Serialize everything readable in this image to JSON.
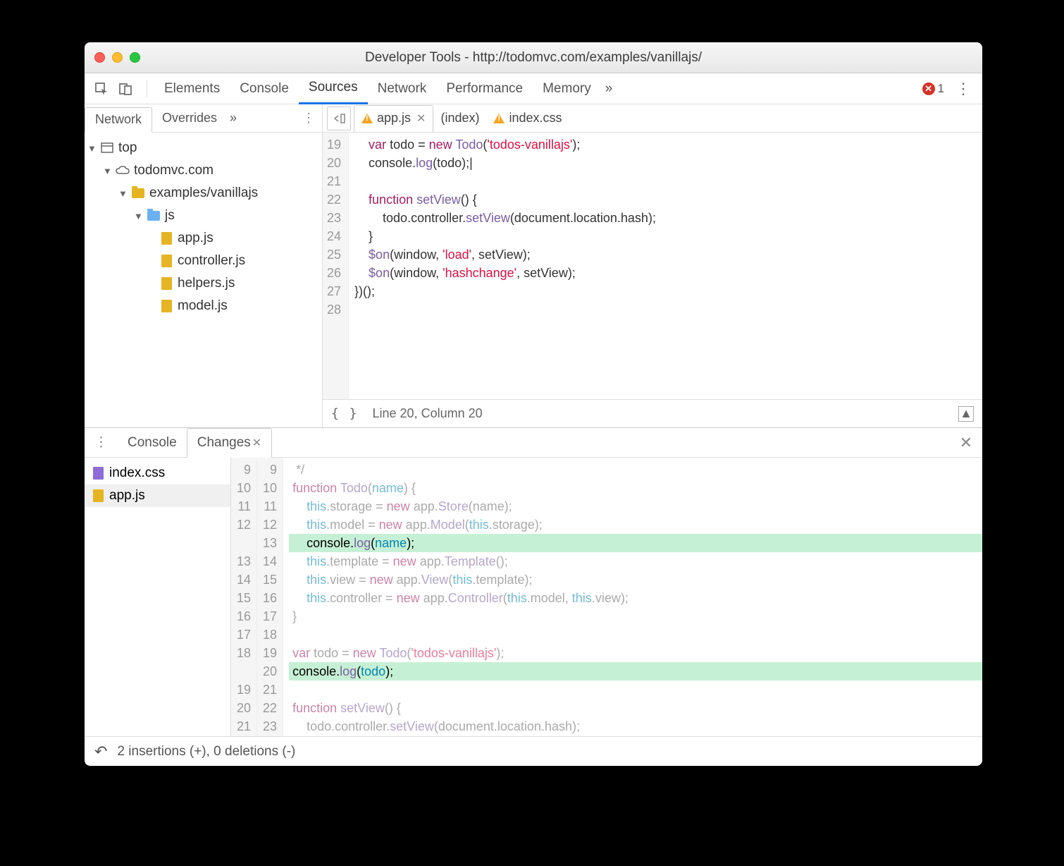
{
  "window": {
    "title": "Developer Tools - http://todomvc.com/examples/vanillajs/"
  },
  "toolbar": {
    "tabs": [
      "Elements",
      "Console",
      "Sources",
      "Network",
      "Performance",
      "Memory"
    ],
    "active_index": 2,
    "overflow_glyph": "»",
    "error_count": "1"
  },
  "left_pane": {
    "tabs": [
      "Network",
      "Overrides"
    ],
    "active_index": 0,
    "overflow_glyph": "»",
    "tree": {
      "root": "top",
      "origin": "todomvc.com",
      "folder": "examples/vanillajs",
      "subfolder": "js",
      "files": [
        "app.js",
        "controller.js",
        "helpers.js",
        "model.js"
      ]
    }
  },
  "editor": {
    "tabs": [
      {
        "name": "app.js",
        "warning": true,
        "active": true,
        "closable": true
      },
      {
        "name": "(index)",
        "warning": false,
        "active": false,
        "closable": false
      },
      {
        "name": "index.css",
        "warning": true,
        "active": false,
        "closable": false
      }
    ],
    "first_line_no": 19,
    "lines_html": [
      "    <span class='kw'>var</span> todo = <span class='kw'>new</span> <span class='fn'>Todo</span>(<span class='str'>'todos-vanillajs'</span>);",
      "    console.<span class='fn'>log</span>(todo);|",
      "",
      "    <span class='kw'>function</span> <span class='fn'>setView</span>() {",
      "        todo.controller.<span class='fn'>setView</span>(document.location.hash);",
      "    }",
      "    <span class='fn'>$on</span>(window, <span class='str'>'load'</span>, setView);",
      "    <span class='fn'>$on</span>(window, <span class='str'>'hashchange'</span>, setView);",
      "})();",
      ""
    ],
    "status": {
      "pretty": "{ }",
      "position": "Line 20, Column 20"
    }
  },
  "drawer": {
    "tabs": [
      "Console",
      "Changes"
    ],
    "active_index": 1,
    "files": [
      {
        "name": "index.css",
        "type": "purple",
        "selected": false
      },
      {
        "name": "app.js",
        "type": "yellow",
        "selected": true
      }
    ],
    "diff": {
      "rows": [
        {
          "old": "9",
          "new": "9",
          "html": "  */",
          "added": false,
          "dim": true
        },
        {
          "old": "10",
          "new": "10",
          "html": " <span class='kw'>function</span> <span class='fn'>Todo</span>(<span class='nm'>name</span>) {",
          "added": false,
          "dim": true
        },
        {
          "old": "11",
          "new": "11",
          "html": "     <span class='this'>this</span>.storage = <span class='kw'>new</span> app.<span class='fn'>Store</span>(name);",
          "added": false,
          "dim": true
        },
        {
          "old": "12",
          "new": "12",
          "html": "     <span class='this'>this</span>.model = <span class='kw'>new</span> app.<span class='fn'>Model</span>(<span class='this'>this</span>.storage);",
          "added": false,
          "dim": true
        },
        {
          "old": "",
          "new": "13",
          "html": "     console.<span class='fn'>log</span>(<span class='nm'>name</span>);",
          "added": true,
          "dim": false
        },
        {
          "old": "13",
          "new": "14",
          "html": "     <span class='this'>this</span>.template = <span class='kw'>new</span> app.<span class='fn'>Template</span>();",
          "added": false,
          "dim": true
        },
        {
          "old": "14",
          "new": "15",
          "html": "     <span class='this'>this</span>.view = <span class='kw'>new</span> app.<span class='fn'>View</span>(<span class='this'>this</span>.template);",
          "added": false,
          "dim": true
        },
        {
          "old": "15",
          "new": "16",
          "html": "     <span class='this'>this</span>.controller = <span class='kw'>new</span> app.<span class='fn'>Controller</span>(<span class='this'>this</span>.model, <span class='this'>this</span>.view);",
          "added": false,
          "dim": true
        },
        {
          "old": "16",
          "new": "17",
          "html": " }",
          "added": false,
          "dim": true
        },
        {
          "old": "17",
          "new": "18",
          "html": "",
          "added": false,
          "dim": true
        },
        {
          "old": "18",
          "new": "19",
          "html": " <span class='kw'>var</span> todo = <span class='kw'>new</span> <span class='fn'>Todo</span>(<span class='str'>'todos-vanillajs'</span>);",
          "added": false,
          "dim": true
        },
        {
          "old": "",
          "new": "20",
          "html": " console.<span class='fn'>log</span>(<span class='nm'>todo</span>);",
          "added": true,
          "dim": false
        },
        {
          "old": "19",
          "new": "21",
          "html": "",
          "added": false,
          "dim": true
        },
        {
          "old": "20",
          "new": "22",
          "html": " <span class='kw'>function</span> <span class='fn'>setView</span>() {",
          "added": false,
          "dim": true
        },
        {
          "old": "21",
          "new": "23",
          "html": "     todo.controller.<span class='fn'>setView</span>(document.location.hash);",
          "added": false,
          "dim": true
        }
      ]
    },
    "status": "2 insertions (+), 0 deletions (-)"
  }
}
